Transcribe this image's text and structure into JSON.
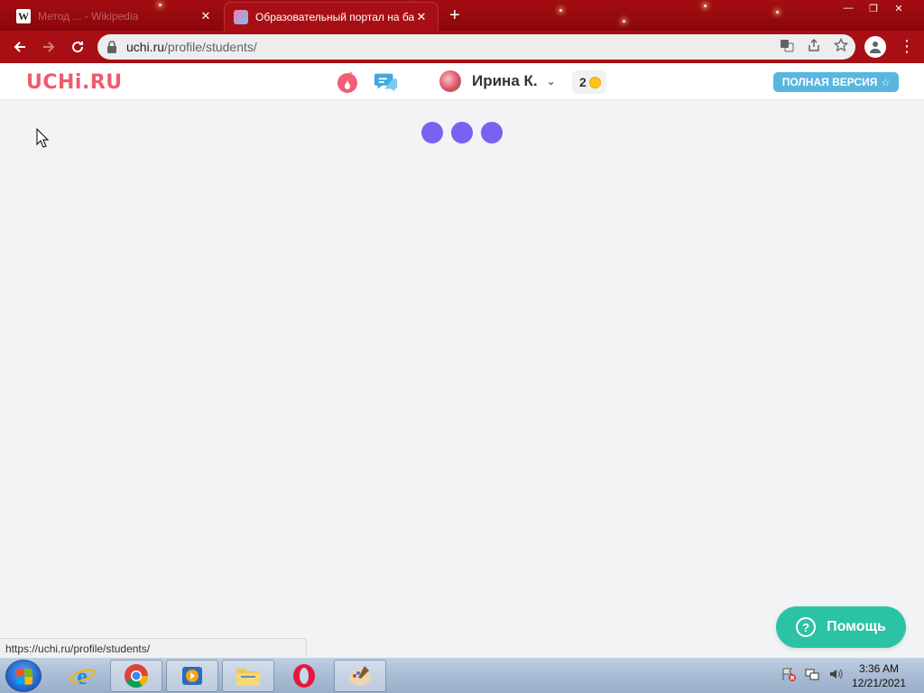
{
  "browser": {
    "tabs": [
      {
        "title": "Метод ... - Wikipedia",
        "favicon": "W",
        "active": false
      },
      {
        "title": "Образовательный портал на ба",
        "active": true
      }
    ],
    "new_tab_label": "+",
    "close_glyph": "✕",
    "window_controls": {
      "minimize": "—",
      "maximize": "❐",
      "close": "✕"
    },
    "address": {
      "host": "uchi.ru",
      "path": "/profile/students/"
    }
  },
  "site": {
    "logo": "UCHi.RU",
    "user": {
      "name": "Ирина К."
    },
    "coins": "2",
    "full_version_label": "ПОЛНАЯ ВЕРСИЯ",
    "full_version_icon": "☆",
    "help_label": "Помощь",
    "help_icon": "?",
    "loading_dots": 3
  },
  "status_bar": {
    "url": "https://uchi.ru/profile/students/"
  },
  "taskbar": {
    "items": [
      "ie-icon",
      "chrome-icon",
      "media-player-icon",
      "explorer-icon",
      "opera-icon",
      "paint-icon"
    ],
    "clock": {
      "time": "3:36 AM",
      "date": "12/21/2021"
    }
  },
  "colors": {
    "brand": "#f05a6e",
    "loader": "#7b61f2",
    "help": "#2bc3a4",
    "full_version": "#59b6e0",
    "browser_theme": "#a80f14"
  }
}
